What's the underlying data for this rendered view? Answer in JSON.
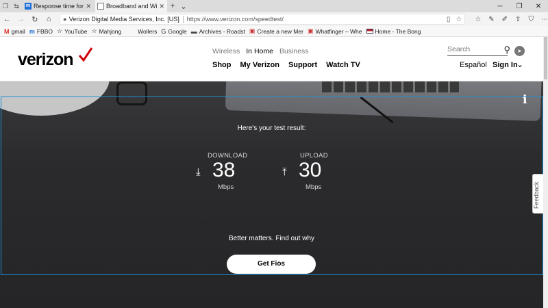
{
  "browser": {
    "tabs": [
      {
        "title": "Response time for repli",
        "favicon": "m-icon"
      },
      {
        "title": "Broadband and Wi-",
        "favicon": "page-icon"
      }
    ],
    "address": {
      "site_identity": "Verizon Digital Media Services, Inc. [US]",
      "url": "https://www.verizon.com/speedtest/"
    },
    "favorites": [
      {
        "label": "gmail",
        "icon": "gmail-icon"
      },
      {
        "label": "FBBO",
        "icon": "fbbo-icon"
      },
      {
        "label": "YouTube",
        "icon": "star-icon"
      },
      {
        "label": "Mahjong",
        "icon": "star-icon"
      },
      {
        "label": "Wollers",
        "icon": ""
      },
      {
        "label": "Google",
        "icon": "google-icon"
      },
      {
        "label": "Archives - Roadst",
        "icon": "folder-icon"
      },
      {
        "label": "Create a new Mer",
        "icon": "page-icon"
      },
      {
        "label": "Whatfinger – Whe",
        "icon": "page-icon"
      },
      {
        "label": "Home - The Bong",
        "icon": "flag-icon"
      }
    ]
  },
  "header": {
    "logo": "verizon",
    "top_links": [
      "Wireless",
      "In Home",
      "Business"
    ],
    "active_top_link": "In Home",
    "nav": [
      "Shop",
      "My Verizon",
      "Support",
      "Watch TV"
    ],
    "search_placeholder": "Search",
    "language": "Español",
    "signin": "Sign In"
  },
  "result": {
    "heading": "Here's your test result:",
    "download": {
      "label": "DOWNLOAD",
      "value": "38",
      "unit": "Mbps"
    },
    "upload": {
      "label": "UPLOAD",
      "value": "30",
      "unit": "Mbps"
    },
    "tagline": "Better matters. Find out why",
    "cta": "Get Fios"
  },
  "feedback": "Feedback",
  "colors": {
    "brand_red": "#cd040b",
    "frame_blue": "#1e90d9",
    "hero_bg": "#2c2c2e"
  }
}
